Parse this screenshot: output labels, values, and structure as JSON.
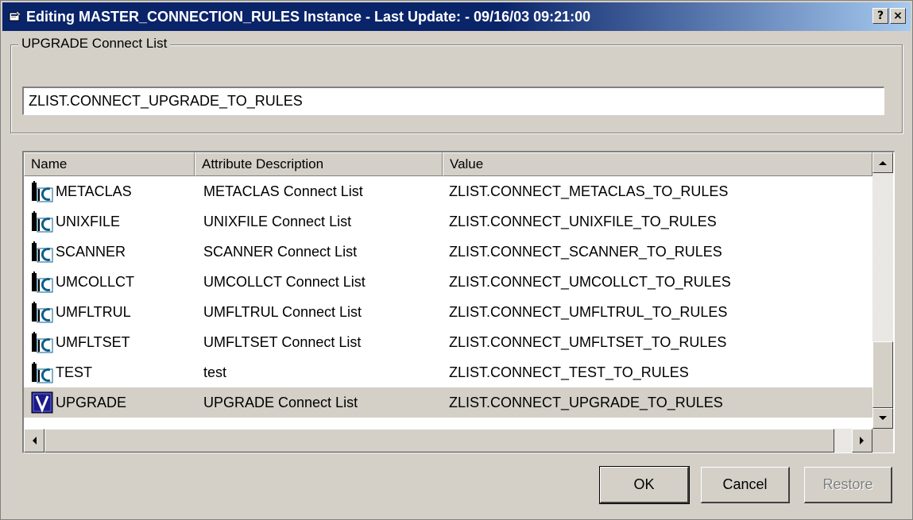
{
  "window": {
    "title": "Editing MASTER_CONNECTION_RULES Instance - Last Update: - 09/16/03 09:21:00",
    "help_button": "?",
    "close_button": "×"
  },
  "group": {
    "label": "UPGRADE Connect List",
    "value": "ZLIST.CONNECT_UPGRADE_TO_RULES"
  },
  "list": {
    "columns": {
      "name": "Name",
      "description": "Attribute Description",
      "value": "Value"
    },
    "rows": [
      {
        "name": "METACLAS",
        "description": "METACLAS Connect List",
        "value": "ZLIST.CONNECT_METACLAS_TO_RULES",
        "icon": "ilc-connect-icon"
      },
      {
        "name": "UNIXFILE",
        "description": "UNIXFILE Connect List",
        "value": "ZLIST.CONNECT_UNIXFILE_TO_RULES",
        "icon": "ilc-connect-icon"
      },
      {
        "name": "SCANNER",
        "description": "SCANNER Connect List",
        "value": "ZLIST.CONNECT_SCANNER_TO_RULES",
        "icon": "ilc-connect-icon"
      },
      {
        "name": "UMCOLLCT",
        "description": "UMCOLLCT Connect List",
        "value": "ZLIST.CONNECT_UMCOLLCT_TO_RULES",
        "icon": "ilc-connect-icon"
      },
      {
        "name": "UMFLTRUL",
        "description": "UMFLTRUL Connect List",
        "value": "ZLIST.CONNECT_UMFLTRUL_TO_RULES",
        "icon": "ilc-connect-icon"
      },
      {
        "name": "UMFLTSET",
        "description": "UMFLTSET Connect List",
        "value": "ZLIST.CONNECT_UMFLTSET_TO_RULES",
        "icon": "ilc-connect-icon"
      },
      {
        "name": "TEST",
        "description": "test",
        "value": "ZLIST.CONNECT_TEST_TO_RULES",
        "icon": "ilc-connect-icon"
      },
      {
        "name": "UPGRADE",
        "description": "UPGRADE Connect List",
        "value": "ZLIST.CONNECT_UPGRADE_TO_RULES",
        "icon": "v-variable-icon"
      }
    ]
  },
  "buttons": {
    "ok": "OK",
    "cancel": "Cancel",
    "restore": "Restore"
  },
  "colors": {
    "titlebar": "#0a246a",
    "face": "#d4d0c8",
    "selected_row": "#d4d0c8"
  }
}
